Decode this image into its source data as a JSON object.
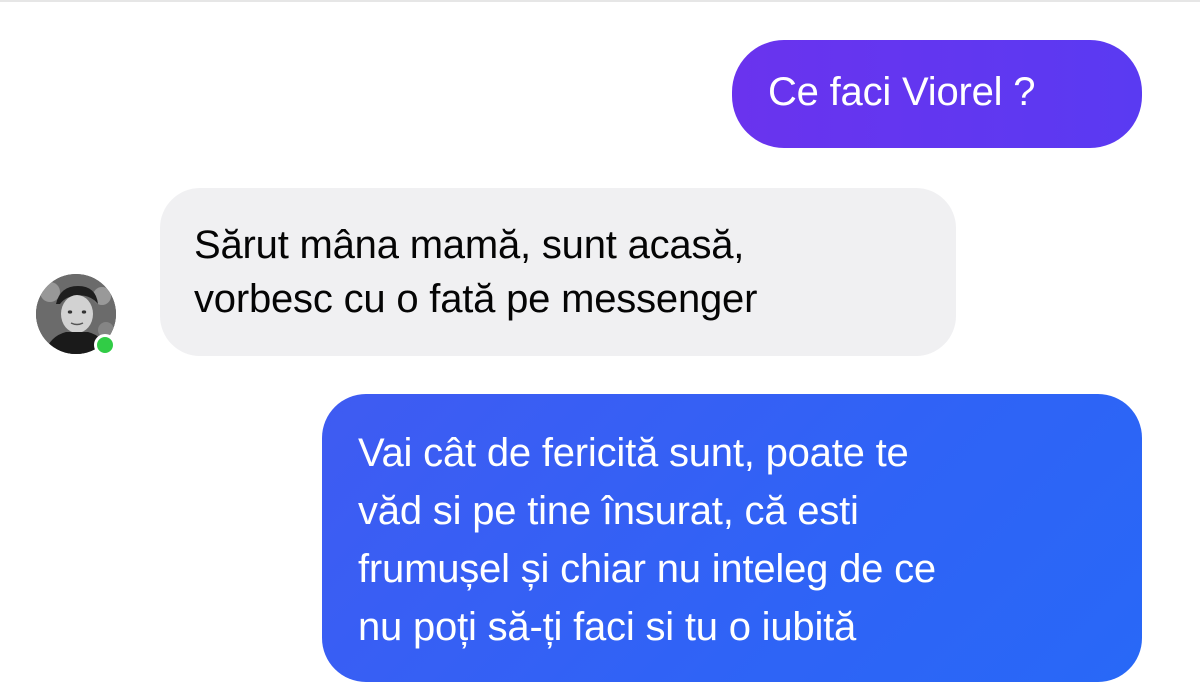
{
  "conversation": {
    "messages": [
      {
        "direction": "outgoing",
        "text": "Ce faci Viorel ?"
      },
      {
        "direction": "incoming",
        "text": "Sărut mâna mamă, sunt acasă,\nvorbesc cu o fată pe messenger"
      },
      {
        "direction": "outgoing",
        "text": "Vai cât de fericită sunt, poate te\nvăd si pe tine însurat, că esti\nfrumușel și chiar nu inteleg de ce\nnu poți să-ți faci si tu o iubită"
      }
    ],
    "contact": {
      "avatar_icon": "user-avatar-photo",
      "status": "online",
      "status_color": "#31cc46"
    }
  },
  "colors": {
    "outgoing_bubble": "#5a3af2",
    "outgoing_bubble_2": "#2f63f6",
    "incoming_bubble": "#f0f0f2",
    "background": "#ffffff"
  }
}
